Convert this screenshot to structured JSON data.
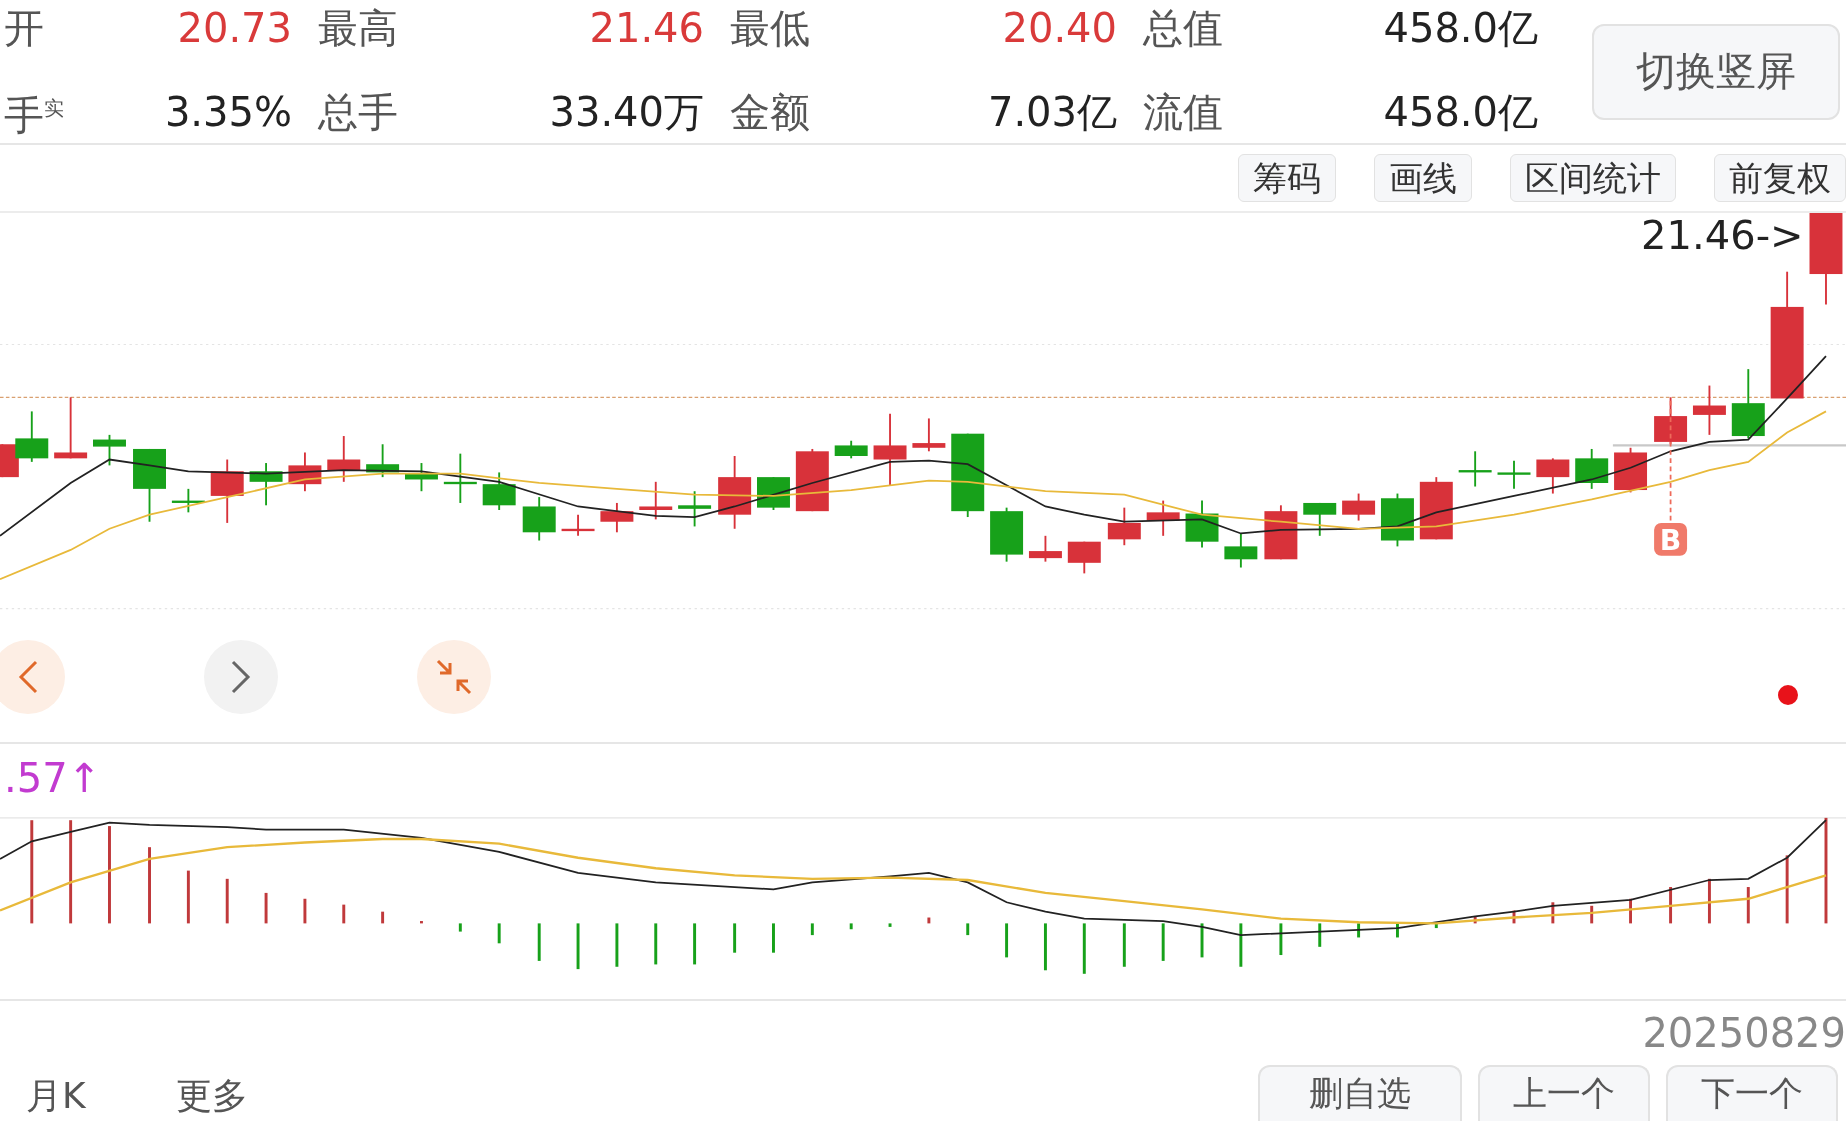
{
  "stats_rows": [
    {
      "items": [
        {
          "label": "开",
          "value": "20.73",
          "color": "#d93a3a"
        },
        {
          "label": "最高",
          "value": "21.46",
          "color": "#d93a3a"
        },
        {
          "label": "最低",
          "value": "20.40",
          "color": "#d93a3a"
        },
        {
          "label": "总值",
          "value": "458.0亿",
          "color": "#222222"
        }
      ]
    },
    {
      "items": [
        {
          "label": "手",
          "sup": "实",
          "value": "3.35%",
          "color": "#222222"
        },
        {
          "label": "总手",
          "value": "33.40万",
          "color": "#222222"
        },
        {
          "label": "金额",
          "value": "7.03亿",
          "color": "#222222"
        },
        {
          "label": "流值",
          "value": "458.0亿",
          "color": "#222222"
        }
      ]
    }
  ],
  "switch_button": "切换竖屏",
  "toolbar": [
    "筹码",
    "画线",
    "区间统计",
    "前复权"
  ],
  "price_chart": {
    "max_label": "21.46->",
    "signal_marker": "B"
  },
  "nav_buttons": [
    {
      "kind": "prev",
      "disabled": false
    },
    {
      "kind": "next",
      "disabled": true
    },
    {
      "kind": "collapse",
      "disabled": false
    }
  ],
  "indicator": {
    "value": ".57↑"
  },
  "date": "20250829",
  "bottom_tabs": [
    "月K",
    "更多"
  ],
  "bottom_actions": [
    "删自选",
    "上一个",
    "下一个"
  ]
}
